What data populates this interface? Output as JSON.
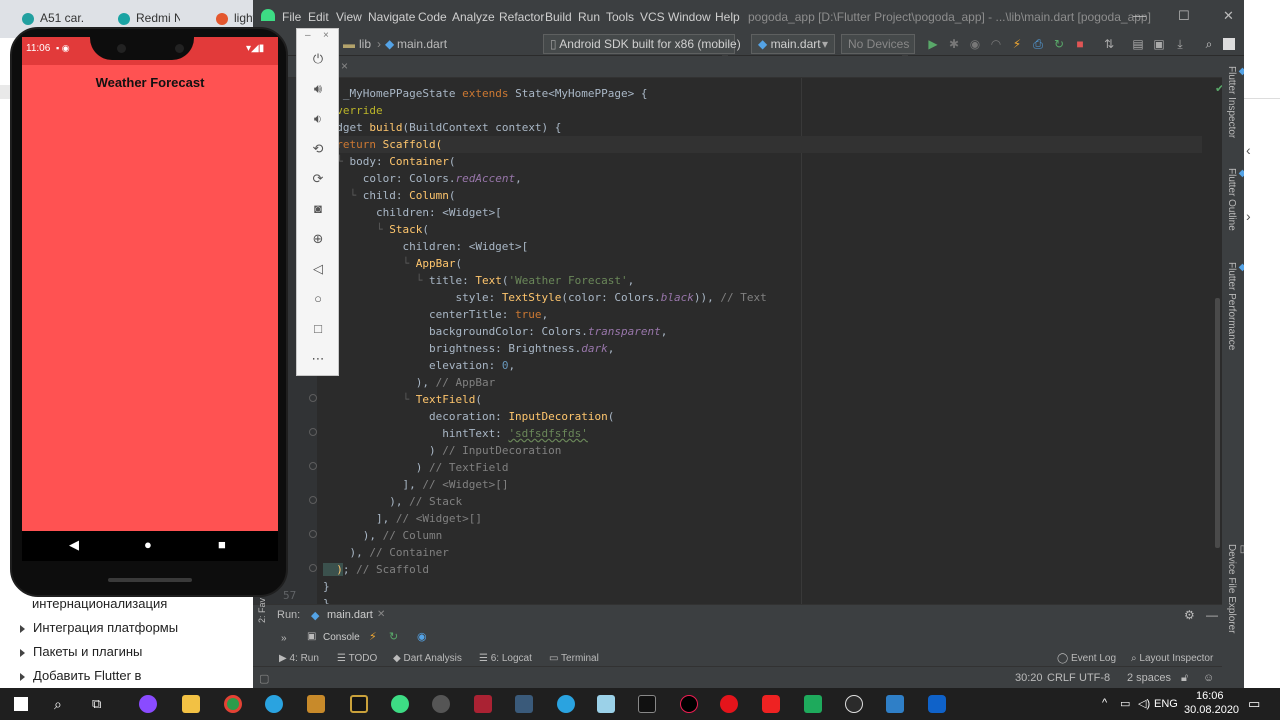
{
  "browser": {
    "tabs": [
      "A51 car...",
      "Redmi N...",
      "lightm..."
    ],
    "doc_items": [
      "интернационализация",
      "Интеграция платформы",
      "Пакеты и плагины",
      "Добавить Flutter в"
    ]
  },
  "ide": {
    "menu": [
      "File",
      "Edit",
      "View",
      "Navigate",
      "Code",
      "Analyze",
      "Refactor",
      "Build",
      "Run",
      "Tools",
      "VCS",
      "Window",
      "Help"
    ],
    "title": "pogoda_app [D:\\Flutter Project\\pogoda_app] - ...\\lib\\main.dart [pogoda_app]",
    "breadcrumbs": [
      "lib",
      "main.dart"
    ],
    "device_combo": "Android SDK built for x86 (mobile)",
    "config_combo": "main.dart",
    "devices_combo": "No Devices",
    "tab_close": "×",
    "code": [
      {
        "t": "ss _MyHomePPageState extends State<MyHomePPage> {"
      },
      {
        "t": "@override"
      },
      {
        "t": "Widget build(BuildContext context) {"
      },
      {
        "t": "  return Scaffold("
      },
      {
        "t": "    body: Container("
      },
      {
        "t": "      color: Colors.redAccent,"
      },
      {
        "t": "      child: Column("
      },
      {
        "t": "        children: <Widget>["
      },
      {
        "t": "          Stack("
      },
      {
        "t": "            children: <Widget>["
      },
      {
        "t": "              AppBar("
      },
      {
        "t": "                title: Text('Weather Forecast',"
      },
      {
        "t": "                    style: TextStyle(color: Colors.black)), // Text"
      },
      {
        "t": "                centerTitle: true,"
      },
      {
        "t": "                backgroundColor: Colors.transparent,"
      },
      {
        "t": "                brightness: Brightness.dark,"
      },
      {
        "t": "                elevation: 0,"
      },
      {
        "t": "              ), // AppBar"
      },
      {
        "t": "              TextField("
      },
      {
        "t": "                decoration: InputDecoration("
      },
      {
        "t": "                  hintText: 'sdfsdfsfds'"
      },
      {
        "t": "                ) // InputDecoration"
      },
      {
        "t": "              ) // TextField"
      },
      {
        "t": "            ], // <Widget>[]"
      },
      {
        "t": "          ), // Stack"
      },
      {
        "t": "        ], // <Widget>[]"
      },
      {
        "t": "      ), // Column"
      },
      {
        "t": "    ), // Container"
      },
      {
        "t": "  ); // Scaffold"
      },
      {
        "t": "}"
      },
      {
        "t": "}"
      }
    ],
    "line_num": "57",
    "run_label": "Run:",
    "run_tab": "main.dart",
    "console": "Console",
    "bottom_tools": [
      "4: Run",
      "TODO",
      "Dart Analysis",
      "6: Logcat",
      "Terminal",
      "Event Log",
      "Layout Inspector"
    ],
    "side_tabs": [
      "Flutter Inspector",
      "Flutter Outline",
      "Flutter Performance",
      "Device File Explorer"
    ],
    "favorites": "2: Fav",
    "status": {
      "pos": "30:20",
      "eol": "CRLF",
      "enc": "UTF-8",
      "indent": "2 spaces"
    }
  },
  "phone": {
    "time": "11:06",
    "appbar_title": "Weather Forecast",
    "bg_color": "#ff5252"
  },
  "taskbar": {
    "lang": "ENG",
    "time": "16:06",
    "date": "30.08.2020"
  }
}
